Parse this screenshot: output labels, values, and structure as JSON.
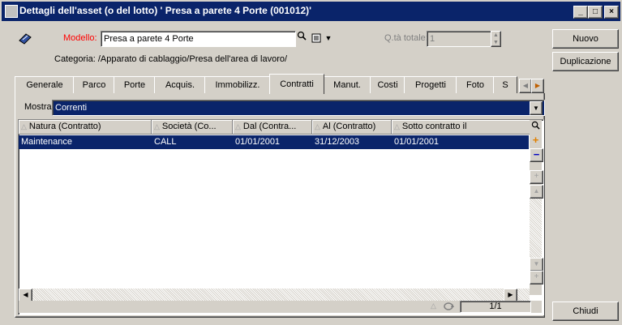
{
  "window": {
    "title": "Dettagli dell'asset (o del lotto) ' Presa a parete 4 Porte (001012)'",
    "controls": [
      "_",
      "□",
      "×"
    ]
  },
  "header": {
    "model_label": "Modello:",
    "model_value": "Presa a parete 4 Porte",
    "qty_label": "Q.tà totale:",
    "qty_value": "1",
    "category_label": "Categoria:",
    "category_value": "/Apparato di cablaggio/Presa dell'area di lavoro/"
  },
  "buttons": {
    "new": "Nuovo",
    "duplicate": "Duplicazione",
    "close": "Chiudi"
  },
  "tabs": [
    "Generale",
    "Parco",
    "Porte",
    "Acquis.",
    "Immobilizz.",
    "Contratti",
    "Manut.",
    "Costi",
    "Progetti",
    "Foto",
    "S"
  ],
  "active_tab": "Contratti",
  "filter": {
    "label": "Mostra:",
    "value": "Correnti"
  },
  "table": {
    "columns": [
      "Natura (Contratto)",
      "Società (Co...",
      "Dal (Contra...",
      "Al (Contratto)",
      "Sotto contratto il"
    ],
    "rows": [
      [
        "Maintenance",
        "CALL",
        "01/01/2001",
        "31/12/2003",
        "01/01/2001"
      ]
    ],
    "pager": "1/1"
  },
  "colors": {
    "title_bg": "#0a246a",
    "selection": "#0a246a",
    "face": "#d4d0c8",
    "model_label": "#ff0000"
  }
}
